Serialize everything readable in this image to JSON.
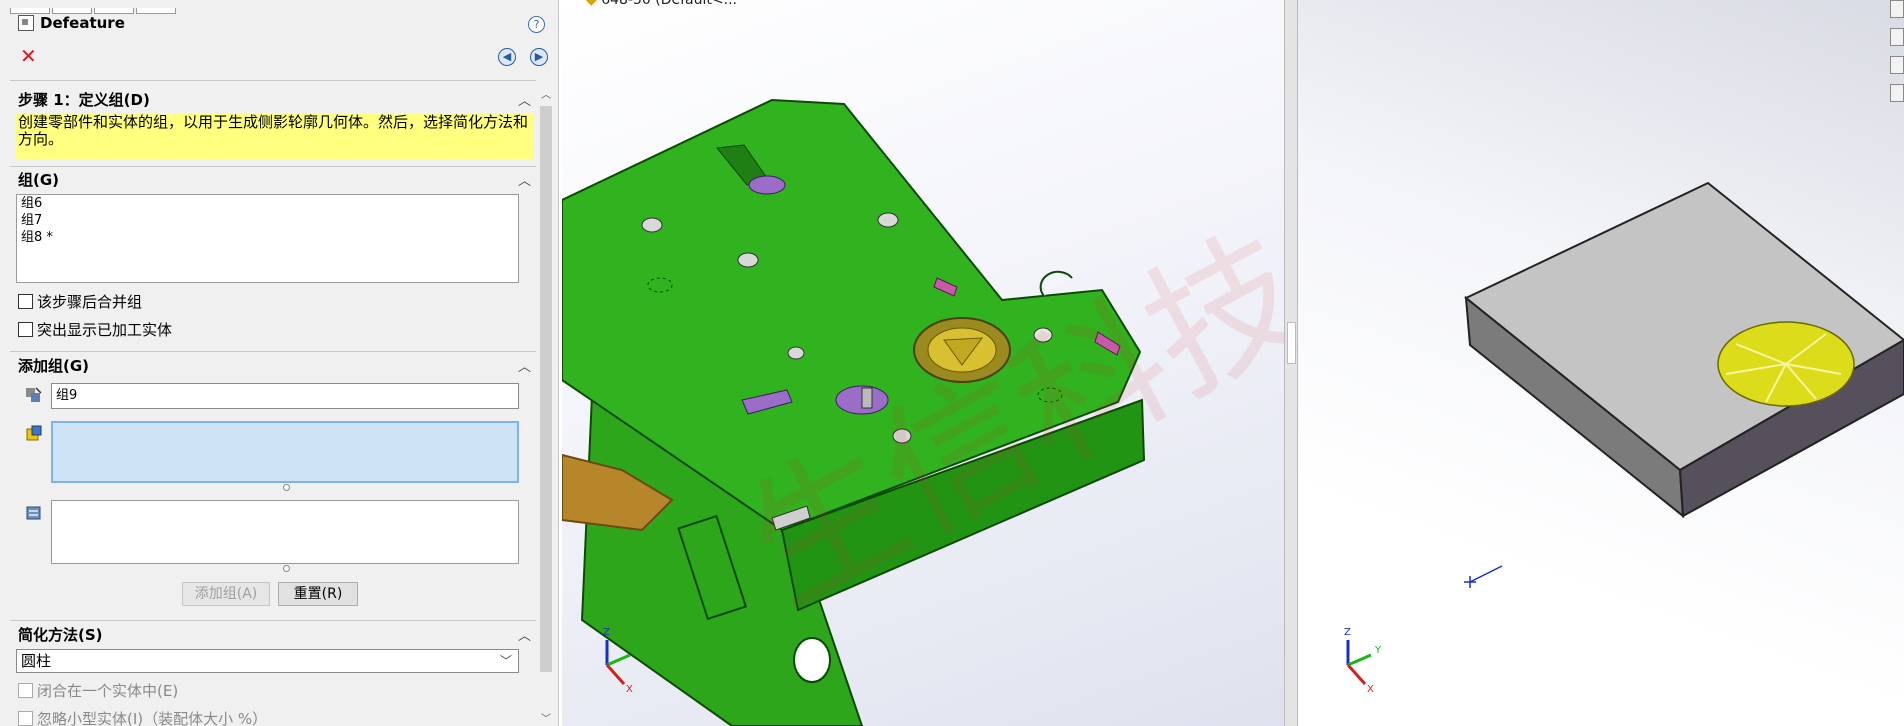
{
  "panel": {
    "title": "Defeature",
    "help_icon": "?",
    "step": {
      "heading": "步骤 1：定义组(D)",
      "hint": "创建零部件和实体的组，以用于生成侧影轮廓几何体。然后，选择简化方法和方向。"
    },
    "groups": {
      "heading": "组(G)",
      "items": [
        "组6",
        "组7",
        "组8 *"
      ],
      "merge_label": "该步骤后合并组",
      "highlight_label": "突出显示已加工实体"
    },
    "add_group": {
      "heading": "添加组(G)",
      "name_value": "组9",
      "add_button": "添加组(A)",
      "reset_button": "重置(R)"
    },
    "simplify": {
      "heading": "简化方法(S)",
      "method_value": "圆柱",
      "enclose_label": "闭合在一个实体中(E)",
      "ignore_small_label": "忽略小型实体(I)（装配体大小 %）"
    }
  },
  "viewport1": {
    "title": "648-50 (Default<..."
  },
  "axes": {
    "x": "X",
    "y": "Y",
    "z": "Z"
  },
  "watermark": "生信科技",
  "colors": {
    "hint_bg": "#ffff80",
    "selection_bg": "#cde4f7",
    "model_green": "#2fa81d",
    "close_red": "#d01c1c",
    "plate_gray": "#c4c4c4"
  }
}
